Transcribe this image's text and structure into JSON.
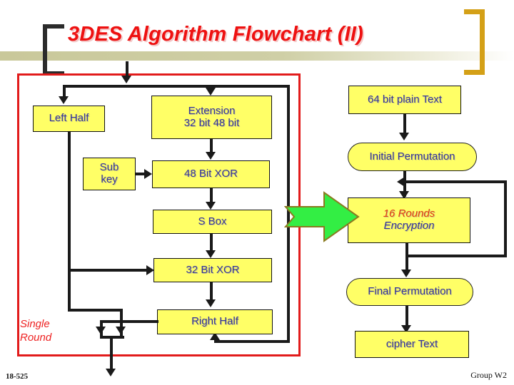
{
  "slide": {
    "title": "3DES Algorithm Flowchart (II)",
    "footer_left": "18-525",
    "footer_right": "Group W2"
  },
  "colors": {
    "title_red": "#ee1111",
    "node_fill": "#ffff66",
    "node_text": "#33339b",
    "frame_red": "#e21b1b",
    "arrow_green": "#33ee44",
    "arrow_green_outline": "#8a7a20",
    "bracket_gold": "#d4a017",
    "band_khaki": "#c9c89a",
    "connector_black": "#1a1a1a"
  },
  "single_round": {
    "label": "Single Round",
    "nodes": {
      "left_half": "Left Half",
      "extension_title": "Extension",
      "extension_sub": "32 bit      48 bit",
      "sub_key_line1": "Sub",
      "sub_key_line2": "key",
      "xor48": "48 Bit XOR",
      "sbox": "S Box",
      "xor32": "32 Bit XOR",
      "right_half": "Right Half"
    }
  },
  "main_flow": {
    "plain_text": "64 bit plain Text",
    "initial_permutation": "Initial Permutation",
    "rounds_line1": "16 Rounds",
    "rounds_line2": "Encryption",
    "final_permutation": "Final Permutation",
    "cipher_text": "cipher Text"
  },
  "icons": {
    "bracket_left": "bracket-open-icon",
    "bracket_right": "bracket-close-icon",
    "green_arrow": "green-right-arrow-icon"
  }
}
